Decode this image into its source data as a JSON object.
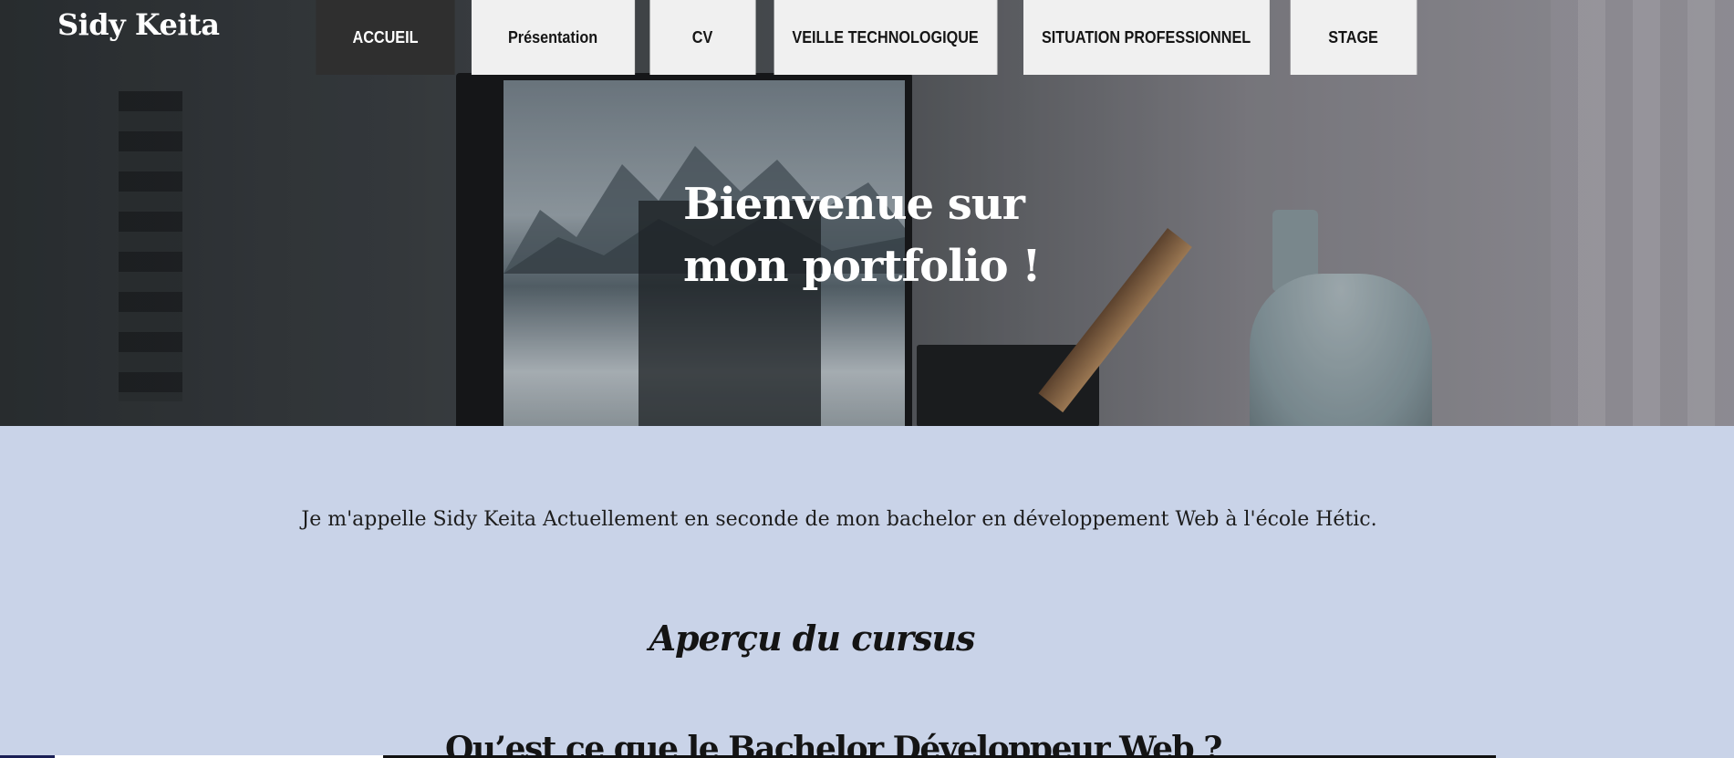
{
  "site": {
    "logo": "Sidy Keita"
  },
  "nav": {
    "items": [
      {
        "label": "ACCUEIL",
        "active": true
      },
      {
        "label": "Présentation",
        "active": false
      },
      {
        "label": "CV",
        "active": false
      },
      {
        "label": "VEILLE TECHNOLOGIQUE",
        "active": false
      },
      {
        "label": "SITUATION PROFESSIONNEL",
        "active": false
      },
      {
        "label": "STAGE",
        "active": false
      }
    ]
  },
  "hero": {
    "title_line1": "Bienvenue sur",
    "title_line2": "mon portfolio !"
  },
  "main": {
    "intro": "Je m'appelle Sidy Keita Actuellement en seconde de mon bachelor en développement Web à l'école Hétic.",
    "section_title": "Aperçu du cursus",
    "sub_title": "Qu’est ce que le Bachelor Développeur Web ?"
  },
  "colors": {
    "nav_bg": "#f0f0f0",
    "nav_active_bg": "#2f2f2f",
    "content_bg": "#c9d3e8"
  }
}
